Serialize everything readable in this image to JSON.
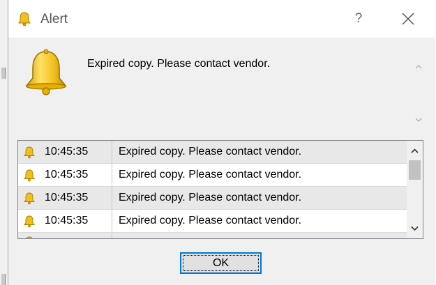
{
  "window": {
    "title": "Alert",
    "help_label": "?"
  },
  "message": "Expired copy. Please contact vendor.",
  "alerts": [
    {
      "time": "10:45:35",
      "text": "Expired copy. Please contact vendor."
    },
    {
      "time": "10:45:35",
      "text": "Expired copy. Please contact vendor."
    },
    {
      "time": "10:45:35",
      "text": "Expired copy. Please contact vendor."
    },
    {
      "time": "10:45:35",
      "text": "Expired copy. Please contact vendor."
    }
  ],
  "buttons": {
    "ok_label": "OK"
  },
  "icons": {
    "title": "bell-icon",
    "message": "bell-icon",
    "row": "bell-icon",
    "close": "close-icon"
  },
  "colors": {
    "accent": "#0078d7",
    "bell_gold": "#f2c01e",
    "row_alt": "#e8e8e8"
  }
}
